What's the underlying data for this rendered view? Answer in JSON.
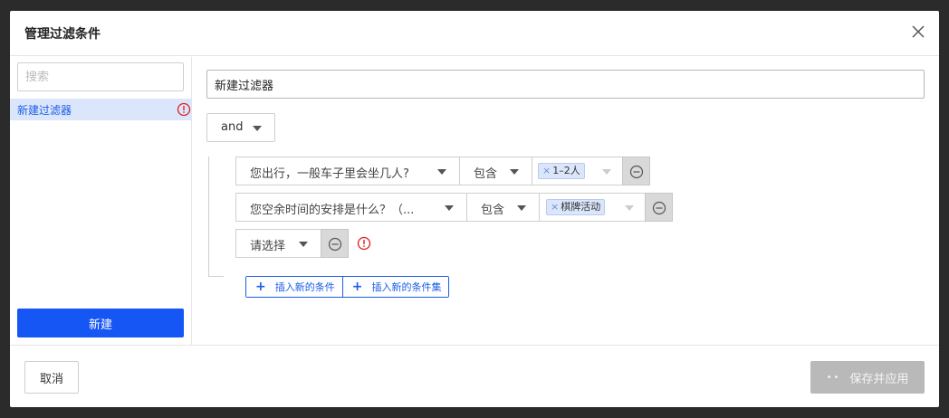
{
  "modal": {
    "title": "管理过滤条件"
  },
  "sidebar": {
    "search_placeholder": "搜索",
    "items": [
      {
        "label": "新建过滤器",
        "status": "warning"
      }
    ],
    "new_button_label": "新建"
  },
  "editor": {
    "filter_name": "新建过滤器",
    "logic_operator": "and",
    "conditions": [
      {
        "field": "您出行，一般车子里会坐几人?",
        "operator": "包含",
        "tags": [
          "1–2人"
        ]
      },
      {
        "field": "您空余时间的安排是什么？（...",
        "operator": "包含",
        "tags": [
          "棋牌活动"
        ]
      },
      {
        "field": "请选择",
        "warning": true
      }
    ],
    "add_condition_label": "插入新的条件",
    "add_condition_set_label": "插入新的条件集"
  },
  "footer": {
    "cancel_label": "取消",
    "save_label": "保存并应用",
    "save_loading_indicator": "••"
  },
  "colors": {
    "primary": "#1656f5",
    "link": "#1a5de8",
    "selected_bg": "#dbe6fb",
    "warning": "#e02020",
    "disabled_button": "#b9b9b9"
  },
  "icons": {
    "close": "close-icon",
    "warning": "warning-circle-icon",
    "remove": "minus-circle-icon",
    "plus": "plus-icon",
    "dropdown": "chevron-down-icon"
  }
}
